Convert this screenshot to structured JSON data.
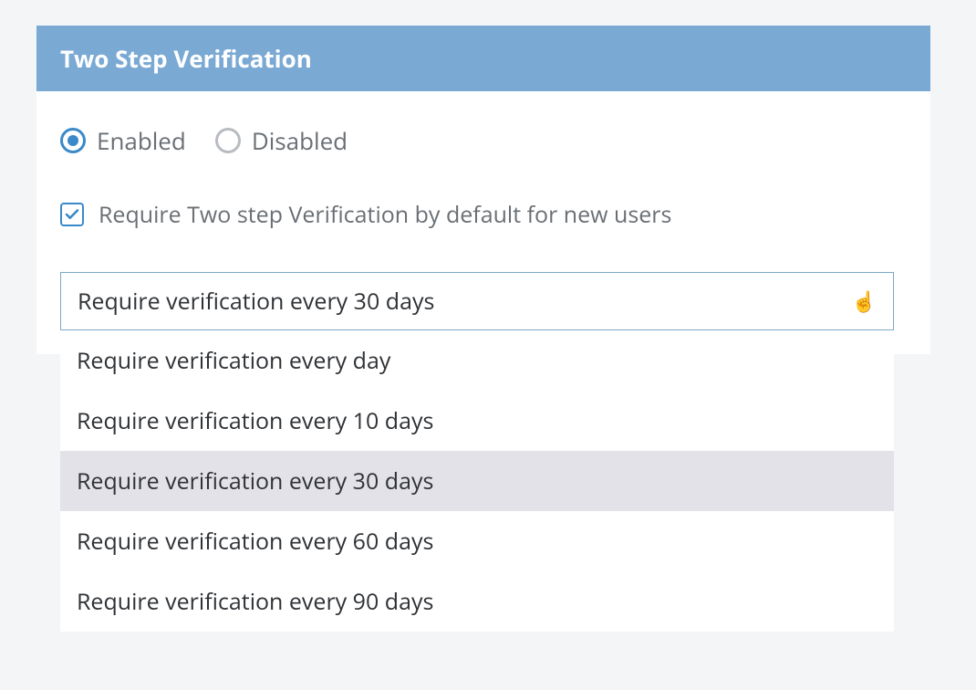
{
  "panel": {
    "title": "Two Step Verification"
  },
  "radios": {
    "enabled": {
      "label": "Enabled",
      "selected": true
    },
    "disabled": {
      "label": "Disabled",
      "selected": false
    }
  },
  "checkbox": {
    "label": "Require Two step Verification by default for new users",
    "checked": true
  },
  "dropdown": {
    "selected_label": "Require verification every 30 days",
    "cursor_glyph": "☝",
    "options": [
      {
        "label": "Require verification every day",
        "highlighted": false
      },
      {
        "label": "Require verification every 10 days",
        "highlighted": false
      },
      {
        "label": "Require verification every 30 days",
        "highlighted": true
      },
      {
        "label": "Require verification every 60 days",
        "highlighted": false
      },
      {
        "label": "Require verification every 90 days",
        "highlighted": false
      }
    ]
  }
}
